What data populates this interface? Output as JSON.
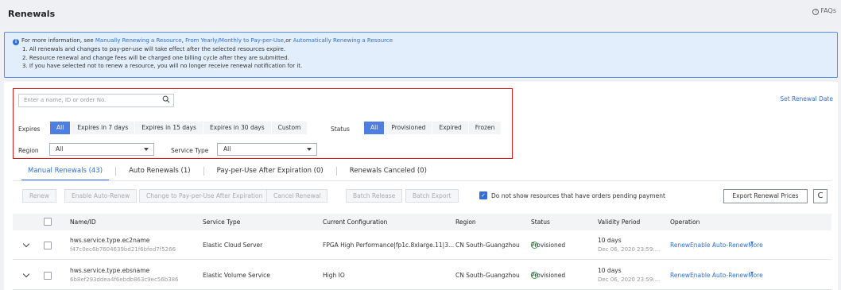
{
  "header": {
    "title": "Renewals",
    "faq": "FAQs"
  },
  "info": {
    "intro": "For more information, see",
    "link1": "Manually Renewing a Resource",
    "sep1": ",",
    "link2": "From Yearly/Monthly to Pay-per-Use",
    "sep2": ",or",
    "link3": "Automatically Renewing a Resource",
    "line1": "1. All renewals and changes to pay-per-use will take effect after the selected resources expire.",
    "line2": "2. Resource renewal and change fees will be charged one billing cycle after they are submitted.",
    "line3": "3. If you have selected not to renew a resource, you will no longer receive renewal notification for it."
  },
  "filters": {
    "search_placeholder": "Enter a name, ID or order No.",
    "set_renewal_date": "Set Renewal Date",
    "expires_label": "Expires",
    "expires_options": [
      "All",
      "Expires in 7 days",
      "Expires in 15 days",
      "Expires in 30 days",
      "Custom"
    ],
    "status_label": "Status",
    "status_options": [
      "All",
      "Provisioned",
      "Expired",
      "Frozen"
    ],
    "region_label": "Region",
    "region_value": "All",
    "service_type_label": "Service Type",
    "service_type_value": "All"
  },
  "tabs": [
    {
      "label": "Manual Renewals (43)"
    },
    {
      "label": "Auto Renewals (1)"
    },
    {
      "label": "Pay-per-Use After Expiration (0)"
    },
    {
      "label": "Renewals Canceled (0)"
    }
  ],
  "toolbar": {
    "renew": "Renew",
    "enable_auto_renew": "Enable Auto-Renew",
    "change_pay_per_use": "Change to Pay-per-Use After Expiration",
    "cancel_renewal": "Cancel Renewal",
    "batch_release": "Batch Release",
    "batch_export": "Batch Export",
    "checkbox_label": "Do not show resources that have orders pending payment",
    "export_prices": "Export Renewal Prices",
    "refresh_glyph": "C"
  },
  "table": {
    "columns": [
      "Name/ID",
      "Service Type",
      "Current Configuration",
      "Region",
      "Status",
      "Validity Period",
      "Operation"
    ],
    "rows": [
      {
        "name": "hws.service.type.ec2name",
        "id": "f47c0ec6b7604639bd21f6bfed7f5266",
        "service_type": "Elastic Cloud Server",
        "config": "FPGA High Performance|fp1c.8xlarge.11|3...",
        "region": "CN South-Guangzhou",
        "status": "Provisioned",
        "validity": "10 days",
        "validity_date": "Dec 06, 2020 23:59:...",
        "op_renew": "Renew",
        "op_auto": "Enable Auto-Renew",
        "op_more": "More"
      },
      {
        "name": "hws.service.type.ebsname",
        "id": "6b8ef293ddea4f6ebdb863c9ec56b386",
        "service_type": "Elastic Volume Service",
        "config": "High IO",
        "region": "CN South-Guangzhou",
        "status": "Provisioned",
        "validity": "10 days",
        "validity_date": "Dec 06, 2020 23:59:...",
        "op_renew": "Renew",
        "op_auto": "Enable Auto-Renew",
        "op_more": "More"
      }
    ]
  },
  "colors": {
    "accent": "#2f6fd6",
    "highlight_border": "#d81b1b",
    "active_segment": "#4f7ee0",
    "success": "#2fa84f"
  }
}
